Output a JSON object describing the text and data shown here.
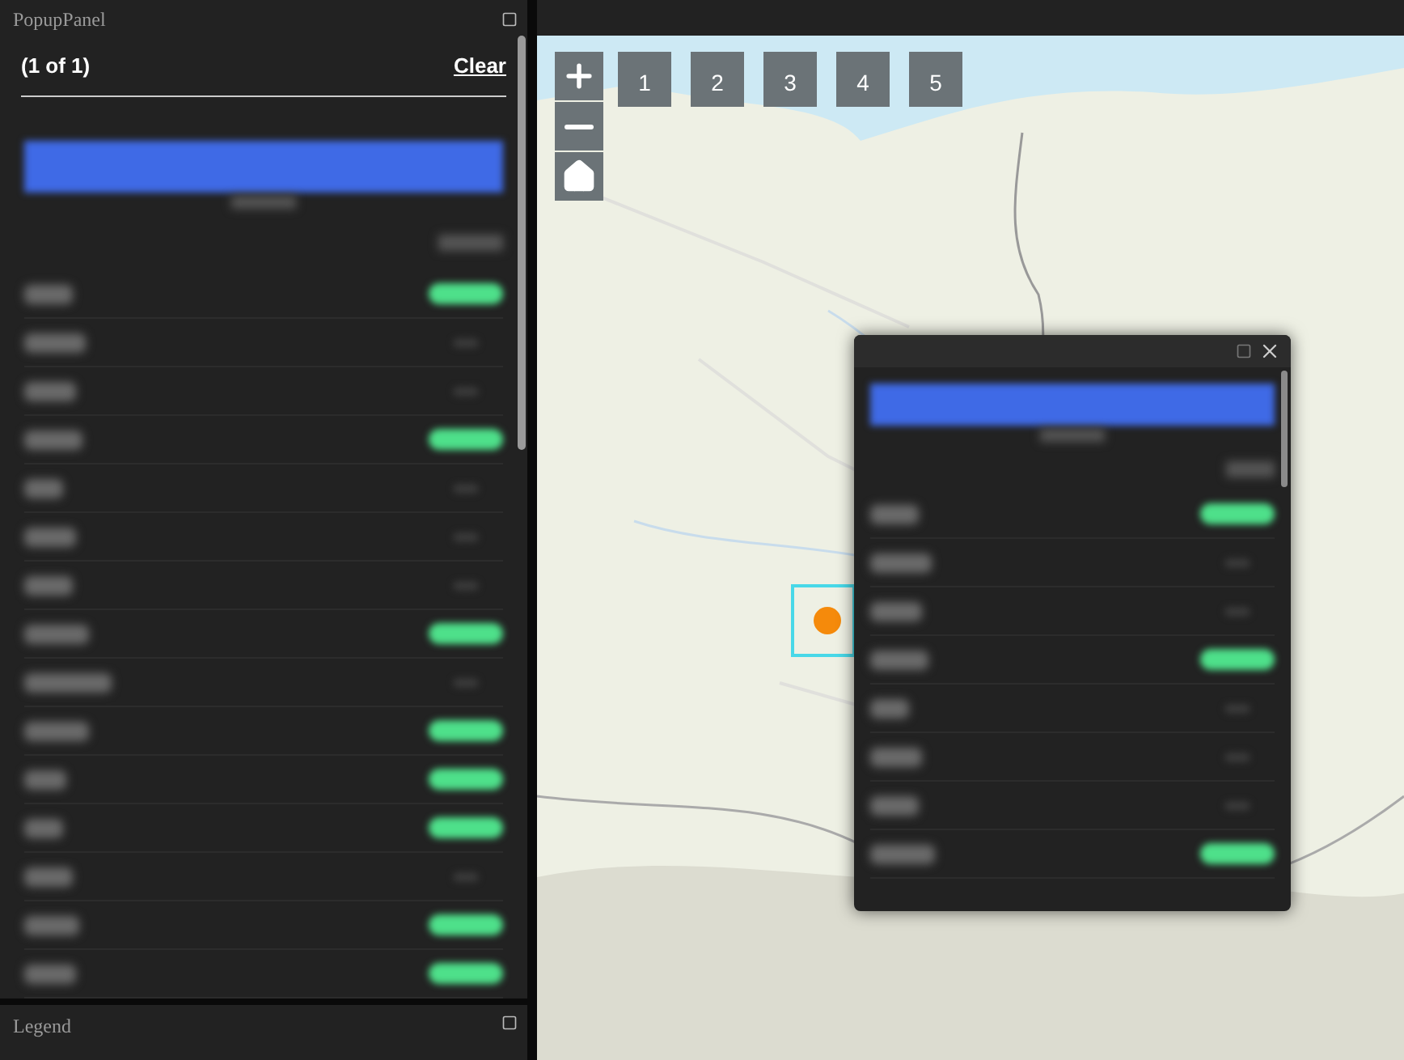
{
  "panel": {
    "title": "PopupPanel",
    "count": "(1 of 1)",
    "clear": "Clear",
    "rows": [
      {
        "highlighted": true
      },
      {
        "highlighted": false
      },
      {
        "highlighted": false
      },
      {
        "highlighted": true
      },
      {
        "highlighted": false
      },
      {
        "highlighted": false
      },
      {
        "highlighted": false
      },
      {
        "highlighted": true
      },
      {
        "highlighted": false
      },
      {
        "highlighted": true
      },
      {
        "highlighted": true
      },
      {
        "highlighted": true
      },
      {
        "highlighted": false
      },
      {
        "highlighted": true
      },
      {
        "highlighted": true
      }
    ]
  },
  "map": {
    "bookmarks": [
      {
        "label": "1"
      },
      {
        "label": "2"
      },
      {
        "label": "3"
      },
      {
        "label": "4"
      },
      {
        "label": "5"
      }
    ],
    "popup": {
      "rows": [
        {
          "highlighted": true
        },
        {
          "highlighted": false
        },
        {
          "highlighted": false
        },
        {
          "highlighted": true
        },
        {
          "highlighted": false
        },
        {
          "highlighted": false
        },
        {
          "highlighted": false
        },
        {
          "highlighted": true
        }
      ]
    }
  },
  "legend": {
    "title": "Legend"
  }
}
